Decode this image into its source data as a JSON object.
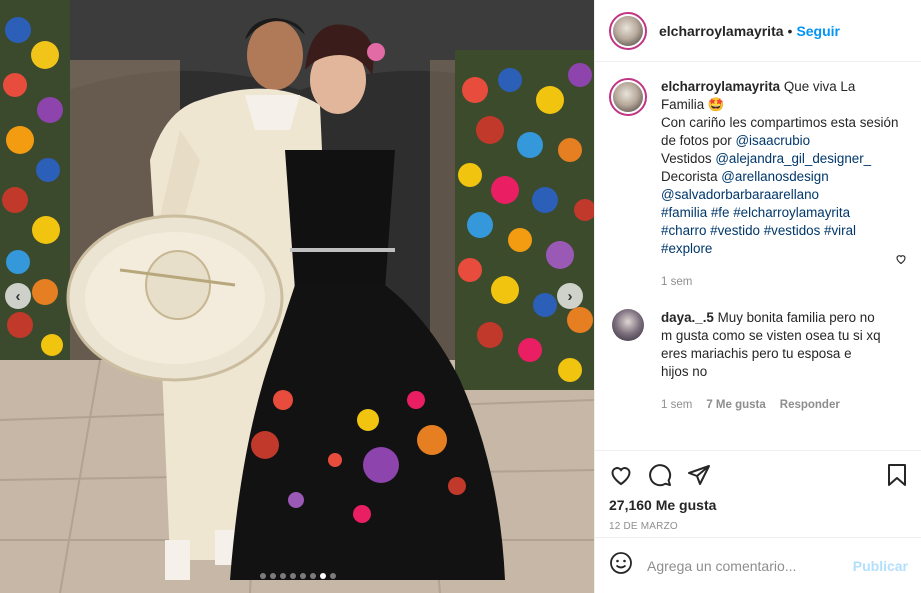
{
  "post": {
    "username": "elcharroylamayrita",
    "separator": "•",
    "follow_label": "Seguir",
    "photo_alt": "Pareja con traje de charro y vestido negro bordado",
    "carousel": {
      "count": 8,
      "active_index": 6
    }
  },
  "caption": {
    "username": "elcharroylamayrita",
    "line1": "Que viva La Familia 🤩",
    "line2_text": "Con cariño les compartimos esta sesión de fotos por ",
    "line2_mention": "@isaacrubio",
    "line3_text": "Vestidos ",
    "line3_mention": "@alejandra_gil_designer_",
    "line4_text": "Decorista ",
    "line4_mention": "@arellanosdesign",
    "line5_mention": "@salvadorbarbaraarellano",
    "hashtags": "#familia #fe #elcharroylamayrita #charro #vestido #vestidos #viral #explore",
    "time": "1 sem"
  },
  "comment": {
    "username": "daya._.5",
    "text": "Muy bonita familia pero no m gusta como se visten osea tu si xq eres mariachis pero tu esposa e hijos no",
    "time": "1 sem",
    "likes": "7 Me gusta",
    "reply": "Responder"
  },
  "actions": {
    "likes": "27,160 Me gusta",
    "date": "12 DE MARZO"
  },
  "add_comment": {
    "placeholder": "Agrega un comentario...",
    "publish_label": "Publicar"
  },
  "icons": {
    "heart": "heart-icon",
    "comment": "comment-icon",
    "share": "share-icon",
    "bookmark": "bookmark-icon",
    "emoji": "emoji-icon",
    "left": "chevron-left-icon",
    "right": "chevron-right-icon"
  },
  "colors": {
    "accent": "#0095f6",
    "link": "#00376b",
    "muted": "#8e8e8e",
    "publish_disabled": "#b2dffc"
  }
}
